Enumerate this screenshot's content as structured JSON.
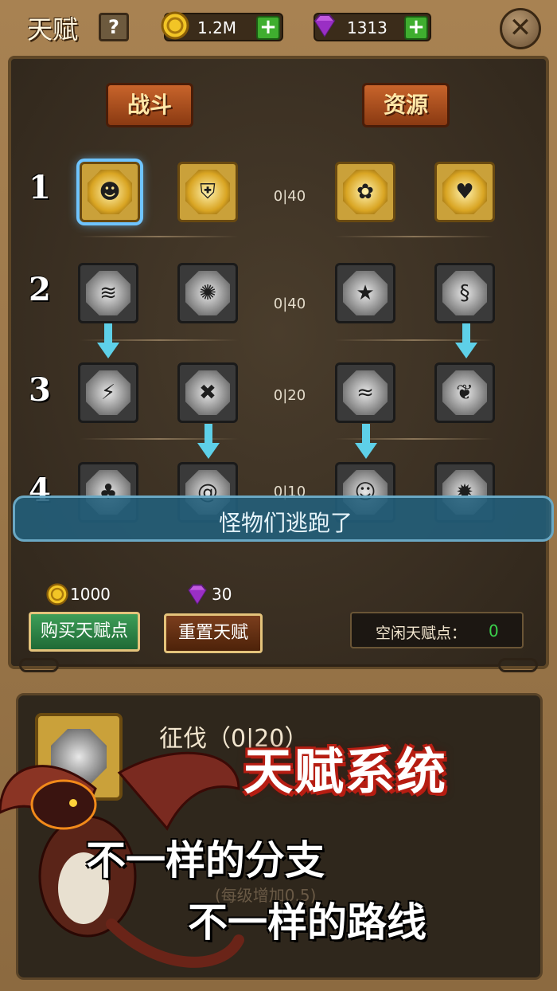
{
  "header": {
    "title": "天赋",
    "help_label": "?",
    "coins": "1.2M",
    "gems": "1313",
    "plus_label": "+",
    "close_label": "✕"
  },
  "tabs": {
    "fight": "战斗",
    "resource": "资源"
  },
  "tree": {
    "rows": [
      {
        "num": "1",
        "counter": "0|40"
      },
      {
        "num": "2",
        "counter": "0|40"
      },
      {
        "num": "3",
        "counter": "0|20"
      },
      {
        "num": "4",
        "counter": "0|10"
      }
    ]
  },
  "toast": "怪物们逃跑了",
  "shop": {
    "coin_price": "1000",
    "gem_price": "30",
    "buy_label": "购买天赋点",
    "reset_label": "重置天赋",
    "free_label": "空闲天赋点：",
    "free_value": "0"
  },
  "detail": {
    "name": "征伐（0|20）",
    "desc": "(每级增加0.5)"
  },
  "promo": {
    "title": "天赋系统",
    "line1": "不一样的分支",
    "line2": "不一样的路线"
  },
  "colors": {
    "accent": "#6fc4ff",
    "arrow": "#5ed0e8",
    "free_points": "#3bd24c",
    "promo_outline": "#b61d12"
  }
}
